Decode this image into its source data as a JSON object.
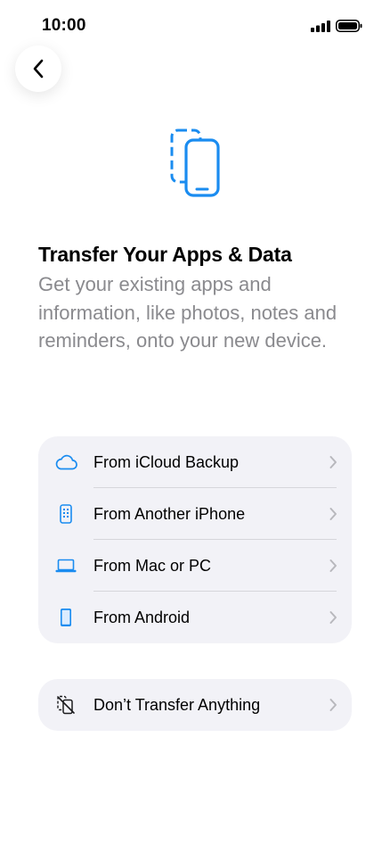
{
  "status_bar": {
    "time": "10:00",
    "signal_icon": "cellular-signal-icon",
    "battery_icon": "battery-icon"
  },
  "navigation": {
    "back_icon": "chevron-left-icon"
  },
  "hero": {
    "icon": "transfer-phones-icon"
  },
  "content": {
    "title": "Transfer Your Apps & Data",
    "subtitle": "Get your existing apps and information, like photos, notes and reminders, onto your new device."
  },
  "options": [
    {
      "label": "From iCloud Backup",
      "icon": "icloud-icon"
    },
    {
      "label": "From Another iPhone",
      "icon": "iphone-icon"
    },
    {
      "label": "From Mac or PC",
      "icon": "laptop-icon"
    },
    {
      "label": "From Android",
      "icon": "android-phone-icon"
    }
  ],
  "skip_option": {
    "label": "Don’t Transfer Anything",
    "icon": "no-transfer-icon"
  },
  "colors": {
    "accent": "#1a8cf0",
    "secondary_text": "#8a8a8e",
    "group_background": "#f2f2f7"
  }
}
